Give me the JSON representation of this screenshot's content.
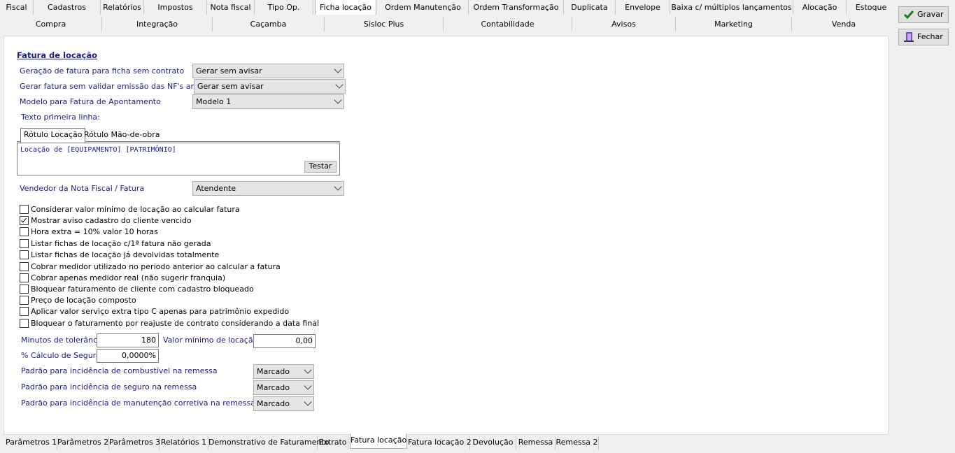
{
  "top_tabs": [
    "Fiscal",
    "Cadastros",
    "Relatórios",
    "Impostos",
    "Nota fiscal",
    "Tipo Op.",
    "Ficha locação",
    "Ordem Manutenção",
    "Ordem Transformação",
    "Duplicata",
    "Envelope",
    "Baixa c/ múltiplos lançamentos",
    "Alocação",
    "Estoque"
  ],
  "top_tabs_active": "Ficha locação",
  "top_tabs2": [
    "Compra",
    "Integração",
    "Caçamba",
    "Sisloc Plus",
    "Contabilidade",
    "Avisos",
    "Marketing",
    "Venda"
  ],
  "buttons": {
    "save": "Gravar",
    "close": "Fechar"
  },
  "section_title": "Fatura de locação",
  "fields": {
    "geracao_label": "Geração de fatura para ficha sem contrato",
    "geracao_value": "Gerar sem avisar",
    "gerar_nf_label": "Gerar fatura sem validar emissão das NF's anteriores",
    "gerar_nf_value": "Gerar sem avisar",
    "modelo_label": "Modelo para Fatura de Apontamento",
    "modelo_value": "Modelo 1",
    "texto_label": "Texto primeira linha:",
    "vendedor_label": "Vendedor da Nota Fiscal / Fatura",
    "vendedor_value": "Atendente"
  },
  "inner_tabs": [
    "Rótulo Locação",
    "Rótulo Mão-de-obra"
  ],
  "memo_text": "Locação de [EQUIPAMENTO] [PATRIMÔNIO]",
  "testar_label": "Testar",
  "checkboxes": [
    {
      "label": "Considerar valor mínimo de locação ao calcular fatura",
      "checked": false
    },
    {
      "label": "Mostrar aviso cadastro do cliente vencido",
      "checked": true
    },
    {
      "label": "Hora extra = 10% valor 10 horas",
      "checked": false
    },
    {
      "label": "Listar fichas de locação c/1ª fatura não gerada",
      "checked": false
    },
    {
      "label": "Listar fichas de locação já devolvidas totalmente",
      "checked": false
    },
    {
      "label": "Cobrar medidor utilizado no periodo anterior ao calcular a fatura",
      "checked": false
    },
    {
      "label": "Cobrar apenas medidor real (não sugerir franquia)",
      "checked": false
    },
    {
      "label": "Bloquear faturamento de cliente com cadastro bloqueado",
      "checked": false
    },
    {
      "label": "Preço de locação composto",
      "checked": false
    },
    {
      "label": "Aplicar valor serviço extra tipo C apenas para patrimônio expedido",
      "checked": false
    },
    {
      "label": "Bloquear o faturamento por reajuste de contrato considerando a data final",
      "checked": false
    }
  ],
  "numeric": {
    "tolerancia_label": "Minutos de tolerância",
    "tolerancia_value": "180",
    "valor_min_label": "Valor mínimo de locação",
    "valor_min_value": "0,00",
    "seguro_label": "% Cálculo de Seguro",
    "seguro_value": "0,0000%"
  },
  "padrao": {
    "combustivel_label": "Padrão para incidência de combustível na remessa",
    "combustivel_value": "Marcado",
    "seguro_label": "Padrão para incidência de seguro na remessa",
    "seguro_value": "Marcado",
    "manutencao_label": "Padrão para incidência de manutenção corretiva na remessa",
    "manutencao_value": "Marcado"
  },
  "bottom_tabs": [
    "Parâmetros 1",
    "Parâmetros 2",
    "Parâmetros 3",
    "Relatórios 1",
    "Demonstrativo de Faturamento",
    "Extrato",
    "Fatura locação",
    "Fatura locação 2",
    "Devolução",
    "Remessa",
    "Remessa 2"
  ],
  "bottom_tabs_active": "Fatura locação",
  "colors": {
    "label_blue": "#1a1a8c",
    "panel_bg": "#ffffff",
    "window_bg": "#f0f0f0"
  }
}
